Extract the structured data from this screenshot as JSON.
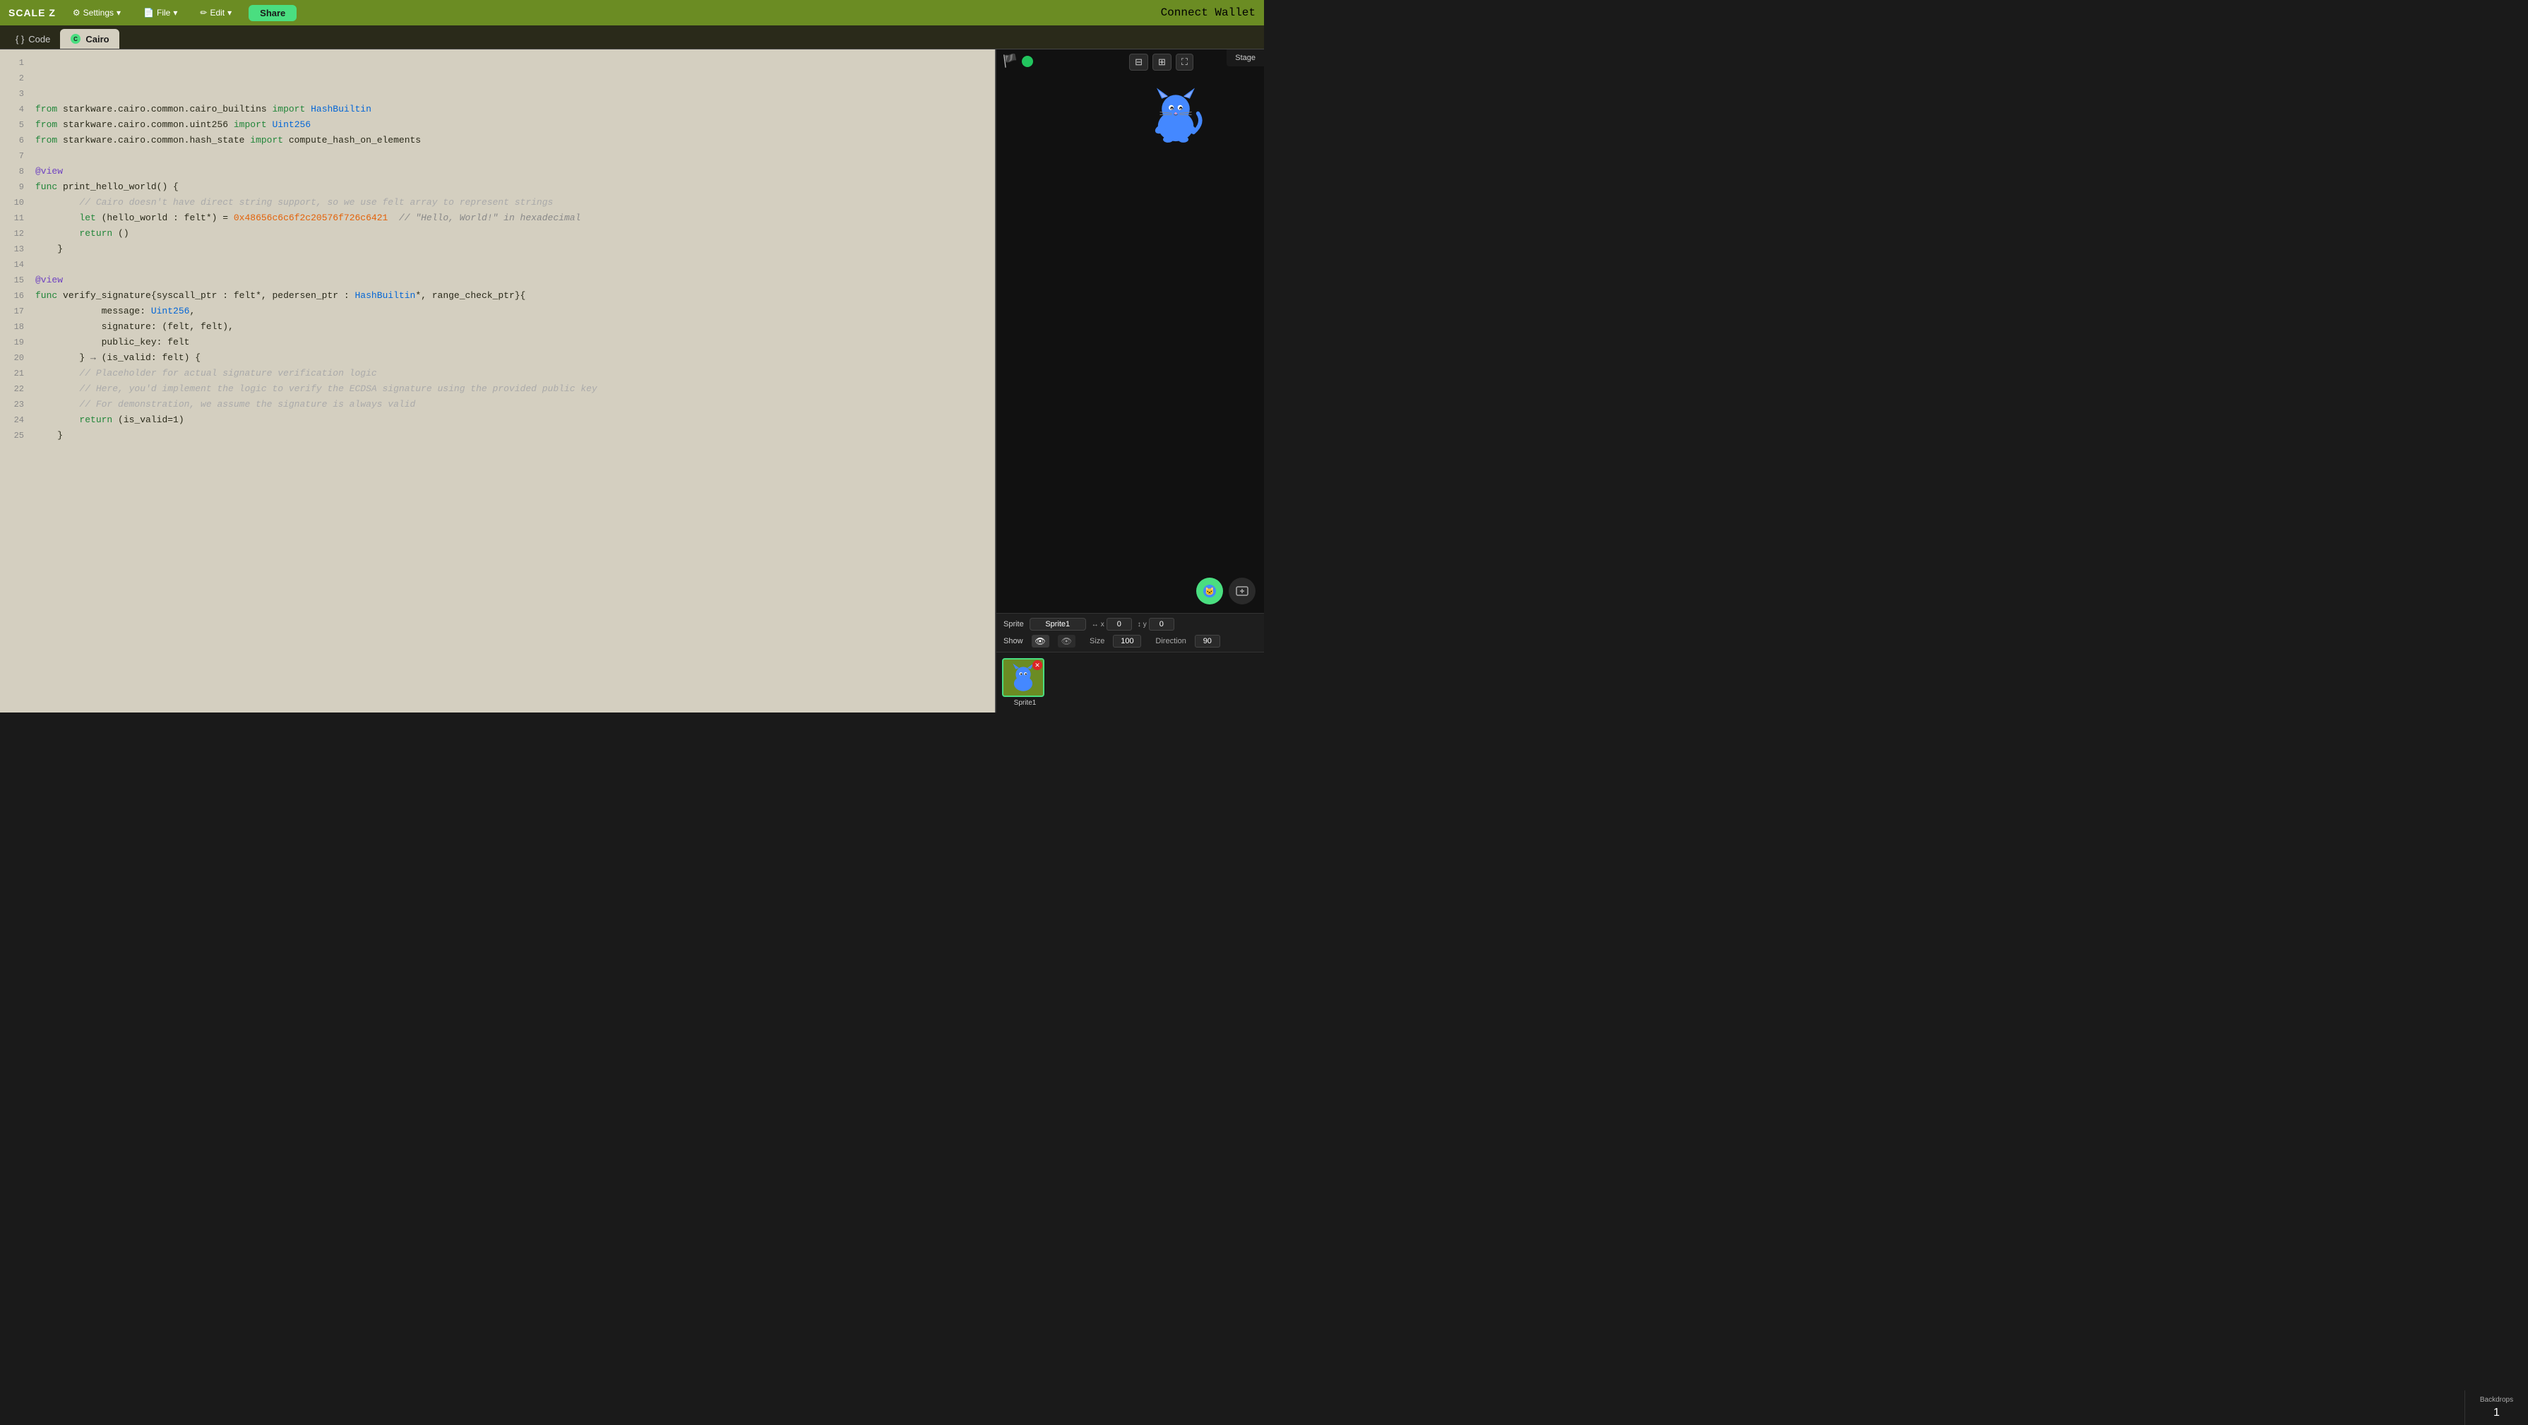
{
  "app": {
    "title": "SCALE Z",
    "connect_wallet": "Connect Wallet"
  },
  "menus": {
    "settings": "Settings",
    "file": "File",
    "edit": "Edit",
    "share": "Share"
  },
  "tabs": {
    "code": "Code",
    "cairo": "Cairo"
  },
  "code_lines": [
    {
      "num": 1,
      "content": ""
    },
    {
      "num": 2,
      "content": ""
    },
    {
      "num": 3,
      "content": ""
    },
    {
      "num": 4,
      "raw": "    from starkware.cairo.common.cairo_builtins import HashBuiltin"
    },
    {
      "num": 5,
      "raw": "    from starkware.cairo.common.uint256 import Uint256"
    },
    {
      "num": 6,
      "raw": "    from starkware.cairo.common.hash_state import compute_hash_on_elements"
    },
    {
      "num": 7,
      "content": ""
    },
    {
      "num": 8,
      "raw": "    @view"
    },
    {
      "num": 9,
      "raw": "    func print_hello_world() {"
    },
    {
      "num": 10,
      "raw": "        // Cairo doesn't have direct string support, so we use felt array to represent strings"
    },
    {
      "num": 11,
      "raw": "        let (hello_world : felt*) = 0x48656c6c6f2c20576f726c6421  // \"Hello, World!\" in hexadecimal"
    },
    {
      "num": 12,
      "raw": "        return ()"
    },
    {
      "num": 13,
      "raw": "    }"
    },
    {
      "num": 14,
      "content": ""
    },
    {
      "num": 15,
      "raw": "    @view"
    },
    {
      "num": 16,
      "raw": "    func verify_signature{syscall_ptr : felt*, pedersen_ptr : HashBuiltin*, range_check_ptr}{"
    },
    {
      "num": 17,
      "raw": "            message: Uint256,"
    },
    {
      "num": 18,
      "raw": "            signature: (felt, felt),"
    },
    {
      "num": 19,
      "raw": "            public_key: felt"
    },
    {
      "num": 20,
      "raw": "        } → (is_valid: felt) {"
    },
    {
      "num": 21,
      "raw": "        // Placeholder for actual signature verification logic"
    },
    {
      "num": 22,
      "raw": "        // Here, you'd implement the logic to verify the ECDSA signature using the provided public key"
    },
    {
      "num": 23,
      "raw": "        // For demonstration, we assume the signature is always valid"
    },
    {
      "num": 24,
      "raw": "        return (is_valid=1)"
    },
    {
      "num": 25,
      "raw": "    }"
    }
  ],
  "sprite": {
    "label": "Sprite",
    "name": "Sprite1",
    "x": "0",
    "y": "0",
    "show_label": "Show",
    "size_label": "Size",
    "size_value": "100",
    "direction_label": "Direction",
    "direction_value": "90",
    "sprite_name": "Sprite1"
  },
  "stage": {
    "label": "Stage",
    "backdrops_label": "Backdrops",
    "backdrops_count": "1"
  },
  "icons": {
    "flag": "🏴",
    "eye_open": "👁",
    "eye_closed": "👁",
    "move_h": "↔",
    "move_v": "↕",
    "expand": "⛶",
    "grid": "⊞",
    "fullscreen": "⛶",
    "cat": "🐱",
    "delete": "✕",
    "arrow_right": "→"
  }
}
